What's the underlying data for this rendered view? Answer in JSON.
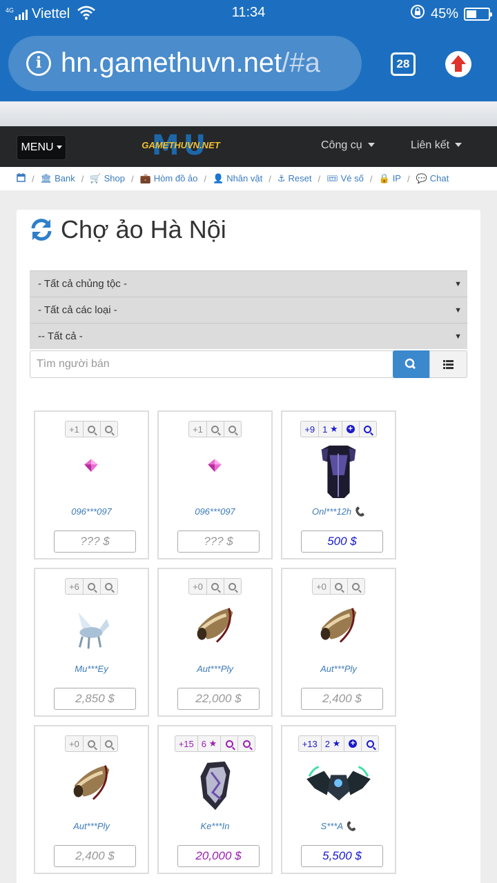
{
  "status_bar": {
    "network_type": "4G",
    "carrier": "Viettel",
    "time": "11:34",
    "battery_percent": "45%",
    "battery_level": 0.45
  },
  "browser": {
    "url_main": "hn.gamethuvn.net",
    "url_rest": "/#a",
    "tab_count": "28"
  },
  "navbar": {
    "menu_label": "MENU",
    "logo_text": "GAMETHUVN.NET",
    "logo_mark": "MU",
    "tools_label": "Công cụ",
    "links_label": "Liên kết"
  },
  "breadcrumbs": [
    {
      "label": ""
    },
    {
      "label": "Bank"
    },
    {
      "label": "Shop"
    },
    {
      "label": "Hòm đồ ảo"
    },
    {
      "label": "Nhân vật"
    },
    {
      "label": "Reset"
    },
    {
      "label": "Vé số"
    },
    {
      "label": "IP"
    },
    {
      "label": "Chat"
    }
  ],
  "page": {
    "title": "Chợ ảo Hà Nội"
  },
  "filters": {
    "race": "- Tất cả chủng tộc -",
    "type": "- Tất cả các loại -",
    "all": "-- Tất cả -",
    "search_placeholder": "Tìm người bán"
  },
  "items": [
    {
      "level": "+1",
      "seller": "096***097",
      "price": "??? $"
    },
    {
      "level": "+1",
      "seller": "096***097",
      "price": "??? $"
    },
    {
      "level": "+9",
      "stars": "1",
      "seller": "Onl***12h",
      "price": "500 $"
    },
    {
      "level": "+6",
      "seller": "Mu***Ey",
      "price": "2,850 $"
    },
    {
      "level": "+0",
      "seller": "Aut***Ply",
      "price": "22,000 $"
    },
    {
      "level": "+0",
      "seller": "Aut***Ply",
      "price": "2,400 $"
    },
    {
      "level": "+0",
      "seller": "Aut***Ply",
      "price": "2,400 $"
    },
    {
      "level": "+15",
      "stars": "6",
      "seller": "Ke***In",
      "price": "20,000 $"
    },
    {
      "level": "+13",
      "stars": "2",
      "seller": "S***A",
      "price": "5,500 $"
    }
  ],
  "colors": {
    "browser_bar": "#1c6fc0",
    "link_blue": "#3a7bbf",
    "excellent_blue": "#1a1acc",
    "ancient_purple": "#9b1fb4",
    "search_button": "#3b88cd"
  }
}
